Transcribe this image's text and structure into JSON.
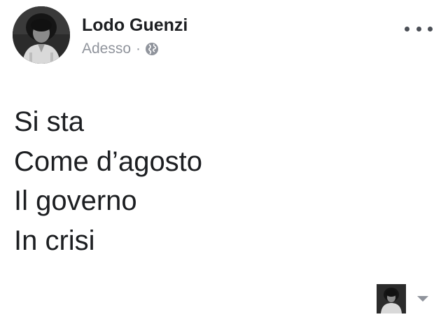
{
  "post": {
    "author": {
      "name": "Lodo Guenzi",
      "avatar_icon": "profile-photo"
    },
    "timestamp": "Adesso",
    "separator": "·",
    "privacy_icon": "globe-icon",
    "more_icon": "more-options-icon",
    "lines": [
      "Si sta",
      "Come d’agosto",
      "Il governo",
      "In crisi"
    ]
  },
  "footer": {
    "actor_icon": "profile-photo",
    "dropdown_icon": "caret-down-icon"
  },
  "colors": {
    "text": "#1c1e21",
    "meta": "#90949c",
    "dots": "#4b4f56"
  }
}
